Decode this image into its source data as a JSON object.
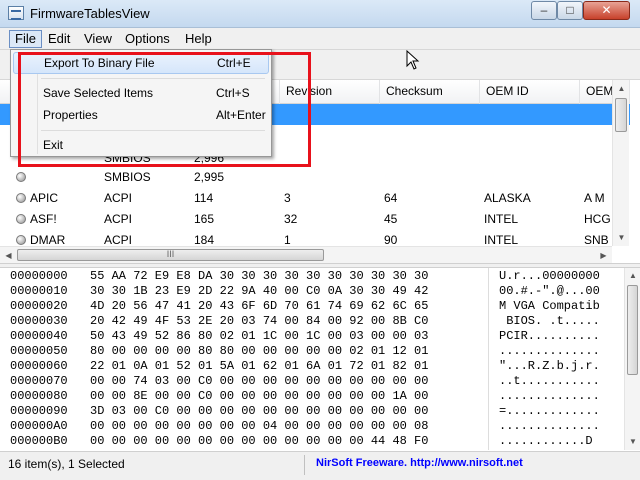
{
  "window": {
    "title": "FirmwareTablesView",
    "min": "–",
    "max": "□",
    "close": "✕"
  },
  "menu": [
    "File",
    "Edit",
    "View",
    "Options",
    "Help"
  ],
  "file_menu": [
    {
      "label": "Export To Binary File",
      "shortcut": "Ctrl+E"
    },
    {
      "label": "Save Selected Items",
      "shortcut": "Ctrl+S"
    },
    {
      "label": "Properties",
      "shortcut": "Alt+Enter"
    },
    {
      "label": "Exit",
      "shortcut": ""
    }
  ],
  "list": {
    "columns": [
      "",
      "",
      "",
      "Revision",
      "Checksum",
      "OEM ID",
      "OEM"
    ],
    "rows": [
      {
        "name": "",
        "provider": "SMBIOS",
        "length": "2,995",
        "revision": "",
        "checksum": "",
        "oem_id": "",
        "oem": ""
      },
      {
        "name": "APIC",
        "provider": "ACPI",
        "length": "114",
        "revision": "3",
        "checksum": "64",
        "oem_id": "ALASKA",
        "oem": "A M"
      },
      {
        "name": "ASF!",
        "provider": "ACPI",
        "length": "165",
        "revision": "32",
        "checksum": "45",
        "oem_id": "INTEL",
        "oem": "HCG"
      },
      {
        "name": "DMAR",
        "provider": "ACPI",
        "length": "184",
        "revision": "1",
        "checksum": "90",
        "oem_id": "INTEL",
        "oem": "SNB"
      }
    ],
    "partial_provider": "SMBIOS",
    "partial_length": "2,996"
  },
  "hex": [
    {
      "off": "00000000",
      "bytes": "55 AA 72 E9 E8 DA 30 30 30 30 30 30 30 30 30 30",
      "ascii": "U.r...00000000"
    },
    {
      "off": "00000010",
      "bytes": "30 30 1B 23 E9 2D 22 9A 40 00 C0 0A 30 30 49 42",
      "ascii": "00.#.-\".@...00"
    },
    {
      "off": "00000020",
      "bytes": "4D 20 56 47 41 20 43 6F 6D 70 61 74 69 62 6C 65",
      "ascii": "M VGA Compatib"
    },
    {
      "off": "00000030",
      "bytes": "20 42 49 4F 53 2E 20 03 74 00 84 00 92 00 8B C0",
      "ascii": " BIOS. .t....."
    },
    {
      "off": "00000040",
      "bytes": "50 43 49 52 86 80 02 01 1C 00 1C 00 03 00 00 03",
      "ascii": "PCIR.........."
    },
    {
      "off": "00000050",
      "bytes": "80 00 00 00 00 80 80 00 00 00 00 00 02 01 12 01",
      "ascii": ".............."
    },
    {
      "off": "00000060",
      "bytes": "22 01 0A 01 52 01 5A 01 62 01 6A 01 72 01 82 01",
      "ascii": "\"...R.Z.b.j.r."
    },
    {
      "off": "00000070",
      "bytes": "00 00 74 03 00 C0 00 00 00 00 00 00 00 00 00 00",
      "ascii": "..t..........."
    },
    {
      "off": "00000080",
      "bytes": "00 00 8E 00 00 C0 00 00 00 00 00 00 00 00 1A 00",
      "ascii": ".............."
    },
    {
      "off": "00000090",
      "bytes": "3D 03 00 C0 00 00 00 00 00 00 00 00 00 00 00 00",
      "ascii": "=............."
    },
    {
      "off": "000000A0",
      "bytes": "00 00 00 00 00 00 00 00 04 00 00 00 00 00 00 08",
      "ascii": ".............."
    },
    {
      "off": "000000B0",
      "bytes": "00 00 00 00 00 00 00 00 00 00 00 00 00 44 48 F0",
      "ascii": "............D"
    }
  ],
  "status": {
    "items": "16 item(s), 1 Selected",
    "credit": "NirSoft Freeware.  http://www.nirsoft.net"
  },
  "scroll": {
    "hthumb_grip": "III"
  }
}
